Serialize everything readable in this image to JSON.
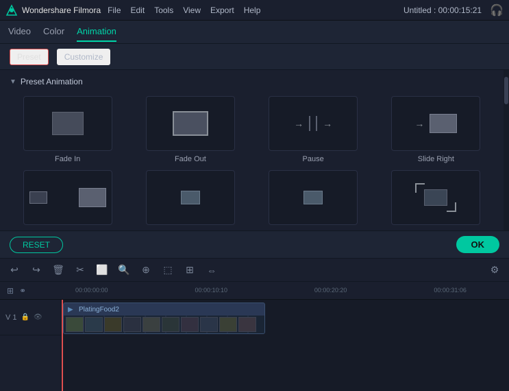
{
  "titlebar": {
    "app_name": "Wondershare Filmora",
    "menus": [
      "File",
      "Edit",
      "Tools",
      "View",
      "Export",
      "Help"
    ],
    "project_info": "Untitled : 00:00:15:21"
  },
  "tabs": {
    "items": [
      "Video",
      "Color",
      "Animation"
    ],
    "active": "Animation"
  },
  "subtabs": {
    "items": [
      "Preset",
      "Customize"
    ],
    "active": "Preset"
  },
  "section": {
    "title": "Preset Animation",
    "arrow": "▼"
  },
  "animations": [
    {
      "id": "fade-in",
      "label": "Fade In"
    },
    {
      "id": "fade-out",
      "label": "Fade Out"
    },
    {
      "id": "pause",
      "label": "Pause"
    },
    {
      "id": "slide-right",
      "label": "Slide Right"
    },
    {
      "id": "row2-1",
      "label": ""
    },
    {
      "id": "row2-2",
      "label": ""
    },
    {
      "id": "row2-3",
      "label": ""
    },
    {
      "id": "row2-4",
      "label": ""
    }
  ],
  "actions": {
    "reset_label": "RESET",
    "ok_label": "OK"
  },
  "toolbar": {
    "icons": [
      "↩",
      "↪",
      "🗑",
      "✂",
      "⬜",
      "🔍",
      "⊕",
      "⬚",
      "⊞",
      "⇔"
    ],
    "right_icon": "⚙"
  },
  "timeline": {
    "track_icons": [
      "1",
      "🔒",
      "👁"
    ],
    "time_markers": [
      "00:00:00:00",
      "00:00:10:10",
      "00:00:20:20",
      "00:00:31:06"
    ],
    "clip_label": "PlatingFood2",
    "playhead_position": "0px"
  }
}
